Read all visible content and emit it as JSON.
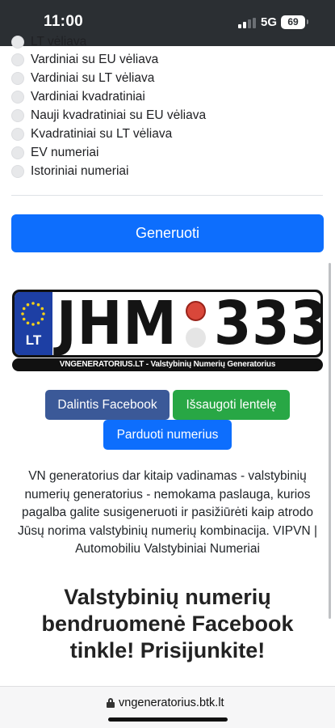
{
  "status_bar": {
    "time": "11:00",
    "network": "5G",
    "battery": "69"
  },
  "radio_options": [
    "LT vėliava",
    "Vardiniai su EU vėliava",
    "Vardiniai su LT vėliava",
    "Vardiniai kvadratiniai",
    "Nauji kvadratiniai su EU vėliava",
    "Kvadratiniai su LT vėliava",
    "EV numeriai",
    "Istoriniai numeriai"
  ],
  "generate_button": "Generuoti",
  "plate": {
    "country_code": "LT",
    "letters": "JHM",
    "numbers": "333",
    "caption": "VNGENERATORIUS.LT - Valstybinių Numerių Generatorius",
    "eu_band_color": "#1d3fa4"
  },
  "actions": {
    "share_facebook": "Dalintis Facebook",
    "save_plate": "Išsaugoti lentelę",
    "sell_numbers": "Parduoti numerius"
  },
  "description": "VN generatorius dar kitaip vadinamas - valstybinių numerių generatorius - nemokama paslauga, kurios pagalba galite susigeneruoti ir pasižiūrėti kaip atrodo Jūsų norima valstybinių numerių kombinacija. VIPVN | Automobiliu Valstybiniai Numeriai",
  "community_heading": "Valstybinių numerių bendruomenė Facebook tinkle! Prisijunkite!",
  "browser": {
    "url": "vngeneratorius.btk.lt"
  },
  "colors": {
    "primary": "#0d6efd",
    "facebook": "#3b5998",
    "success": "#28a745"
  }
}
